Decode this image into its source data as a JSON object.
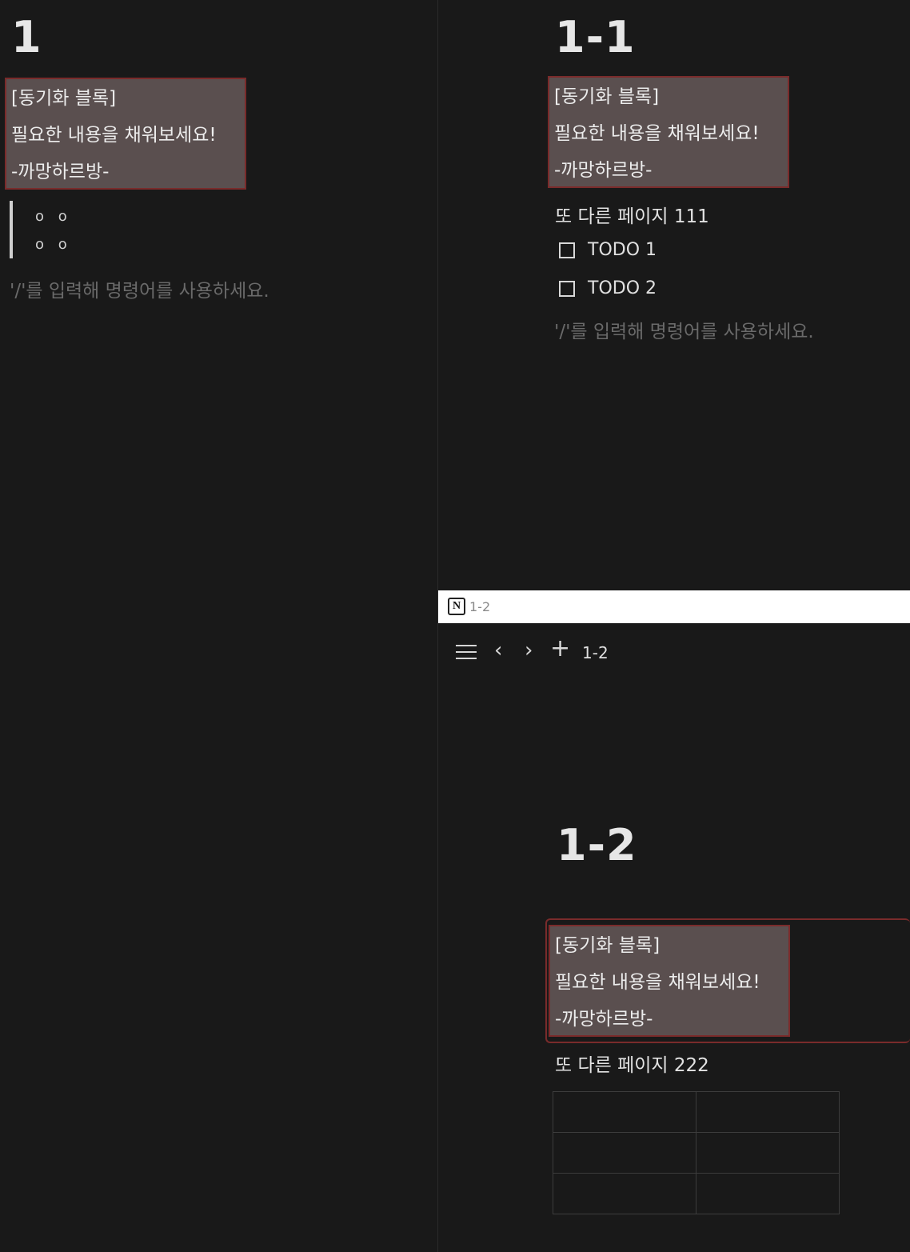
{
  "left_pane": {
    "title": "1",
    "sync_block": {
      "line1": "[동기화 블록]",
      "line2": "필요한 내용을 채워보세요!",
      "line3": "-까망하르방-"
    },
    "quote_dots": [
      "o o",
      "o o"
    ],
    "placeholder": "'/'를 입력해 명령어를 사용하세요."
  },
  "right_top_pane": {
    "title": "1-1",
    "sync_block": {
      "line1": "[동기화 블록]",
      "line2": "필요한 내용을 채워보세요!",
      "line3": "-까망하르방-"
    },
    "text": "또 다른 페이지 111",
    "todos": [
      "TODO 1",
      "TODO 2"
    ],
    "placeholder": "'/'를 입력해 명령어를 사용하세요."
  },
  "right_bottom_pane": {
    "window_title": "1-2",
    "breadcrumb": "1-2",
    "title": "1-2",
    "sync_block": {
      "line1": "[동기화 블록]",
      "line2": "필요한 내용을 채워보세요!",
      "line3": "-까망하르방-"
    },
    "text": "또 다른 페이지 222",
    "table": {
      "rows": 3,
      "cols": 2
    }
  },
  "colors": {
    "background": "#191919",
    "sync_block_bg": "#5a4f4f",
    "sync_block_border": "#7a2b2b"
  },
  "icons": {
    "app": "notion-logo-icon",
    "menu": "hamburger-menu-icon",
    "back": "chevron-left-icon",
    "forward": "chevron-right-icon",
    "add": "plus-icon"
  }
}
